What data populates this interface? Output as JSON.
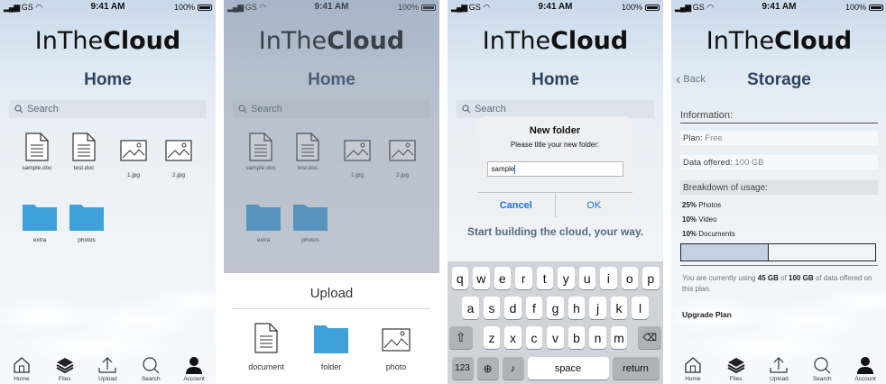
{
  "colors": {
    "folder": "#3ea1d9",
    "accent": "#1a73e8",
    "title": "#2e4460"
  },
  "status": {
    "carrier": "GS",
    "time": "9:41 AM",
    "battery": "100%"
  },
  "brand": {
    "prefix": "InThe",
    "bold": "Cloud"
  },
  "home": {
    "title": "Home",
    "search_placeholder": "Search",
    "files": [
      {
        "name": "sample.doc",
        "icon": "document-icon"
      },
      {
        "name": "test.doc",
        "icon": "document-icon"
      },
      {
        "name": "1.jpg",
        "icon": "image-icon"
      },
      {
        "name": "2.jpg",
        "icon": "image-icon"
      }
    ],
    "folders": [
      {
        "name": "extra",
        "icon": "folder-icon"
      },
      {
        "name": "photos",
        "icon": "folder-icon"
      }
    ]
  },
  "upload_sheet": {
    "title": "Upload",
    "options": [
      {
        "label": "document",
        "icon": "document-icon"
      },
      {
        "label": "folder",
        "icon": "folder-icon"
      },
      {
        "label": "photo",
        "icon": "image-icon"
      }
    ]
  },
  "new_folder_dialog": {
    "title": "New folder",
    "message": "Please title your new folder:",
    "value": "sample",
    "cancel": "Cancel",
    "ok": "OK"
  },
  "tagline": "Start building the cloud, your way.",
  "keyboard": {
    "row1": [
      "q",
      "w",
      "e",
      "r",
      "t",
      "y",
      "u",
      "i",
      "o",
      "p"
    ],
    "row2": [
      "a",
      "s",
      "d",
      "f",
      "g",
      "h",
      "j",
      "k",
      "l"
    ],
    "row3": [
      "z",
      "x",
      "c",
      "v",
      "b",
      "n",
      "m"
    ],
    "numbers": "123",
    "space": "space",
    "return": "return"
  },
  "storage": {
    "back": "Back",
    "title": "Storage",
    "info_heading": "Information:",
    "plan_label": "Plan:",
    "plan_value": "Free",
    "offered_label": "Data offered:",
    "offered_value": "100 GB",
    "breakdown_heading": "Breakdown of usage:",
    "usage": [
      {
        "pct": "25%",
        "label": "Photos"
      },
      {
        "pct": "10%",
        "label": "Video"
      },
      {
        "pct": "10%",
        "label": "Documents"
      }
    ],
    "used_fraction": 0.45,
    "note_prefix": "You are currently using",
    "used": "45 GB",
    "note_of": "of",
    "total": "100 GB",
    "note_suffix": "of data offered on this plan.",
    "upgrade": "Upgrade Plan"
  },
  "tabs": [
    {
      "label": "Home",
      "icon": "home-icon"
    },
    {
      "label": "Files",
      "icon": "files-icon"
    },
    {
      "label": "Upload",
      "icon": "upload-icon"
    },
    {
      "label": "Search",
      "icon": "search-icon"
    },
    {
      "label": "Account",
      "icon": "account-icon"
    }
  ]
}
